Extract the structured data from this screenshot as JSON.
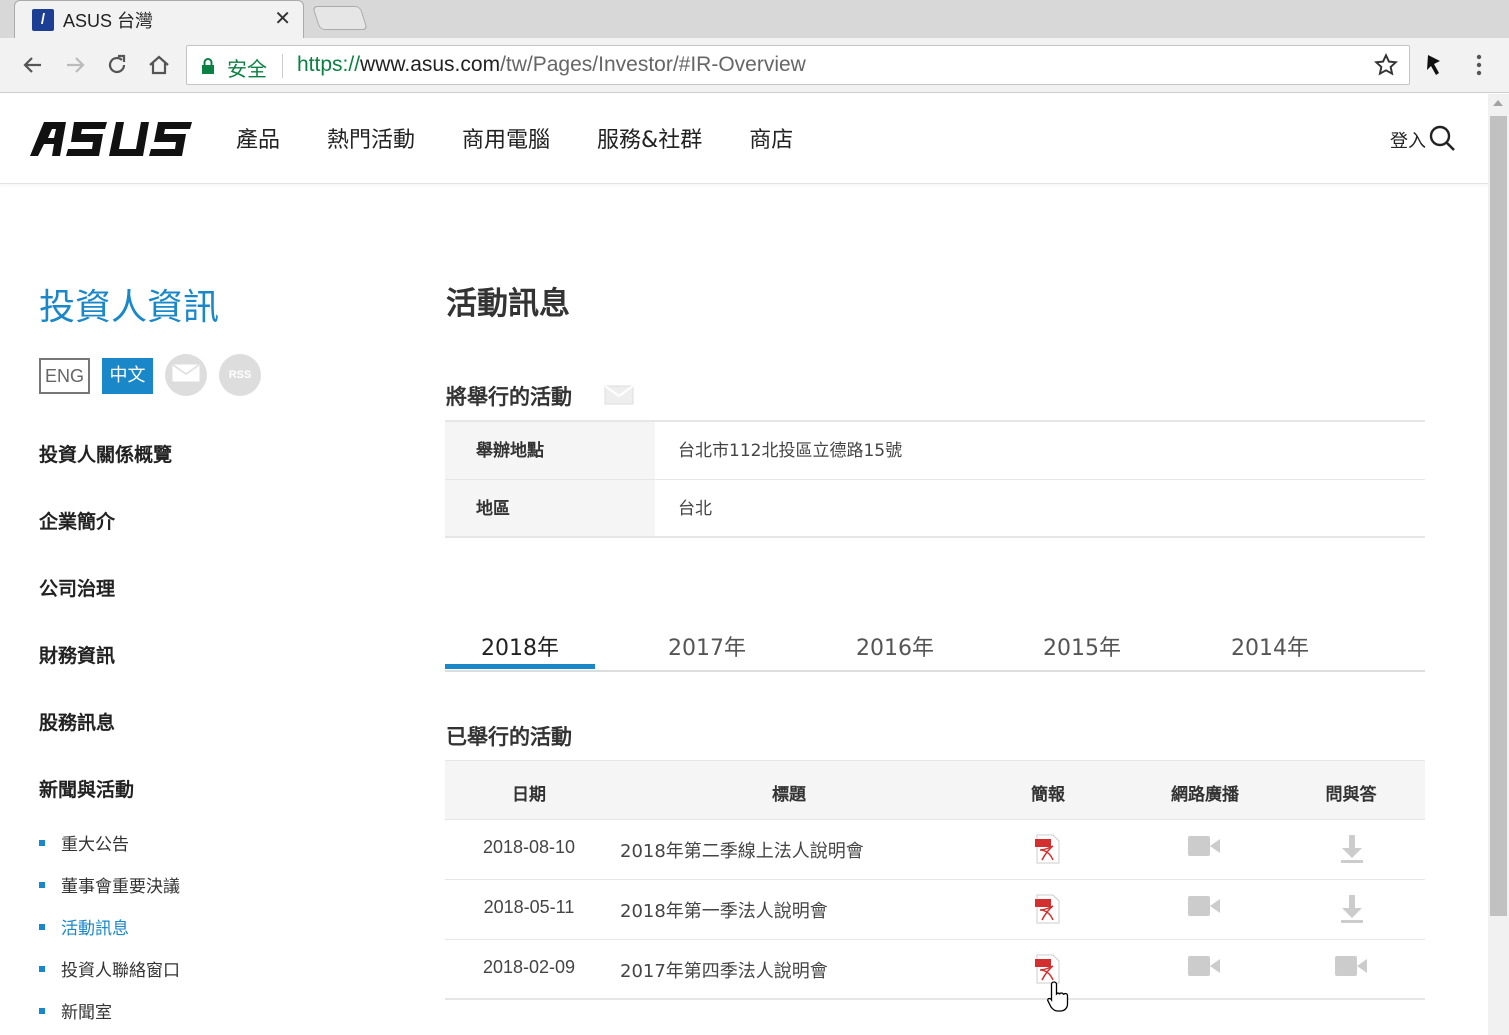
{
  "browser": {
    "tab_title": "ASUS 台灣",
    "tab_close": "✕",
    "secure_label": "安全",
    "url_scheme": "https://",
    "url_host": "www.asus.com",
    "url_path": "/tw/Pages/Investor/#IR-Overview"
  },
  "header": {
    "logo_alt": "ASUS",
    "nav": [
      "產品",
      "熱門活動",
      "商用電腦",
      "服務&社群",
      "商店"
    ],
    "login": "登入"
  },
  "sidebar": {
    "title": "投資人資訊",
    "lang_eng": "ENG",
    "lang_zh": "中文",
    "rss": "RSS",
    "items": [
      "投資人關係概覽",
      "企業簡介",
      "公司治理",
      "財務資訊",
      "股務訊息",
      "新聞與活動"
    ],
    "sub_items": [
      "重大公告",
      "董事會重要決議",
      "活動訊息",
      "投資人聯絡窗口",
      "新聞室"
    ],
    "active_sub_index": 2
  },
  "content": {
    "page_title": "活動訊息",
    "upcoming_title": "將舉行的活動",
    "info": [
      {
        "label": "舉辦地點",
        "value": "台北市112北投區立德路15號"
      },
      {
        "label": "地區",
        "value": "台北"
      }
    ],
    "year_tabs": [
      "2018年",
      "2017年",
      "2016年",
      "2015年",
      "2014年"
    ],
    "active_year_index": 0,
    "held_title": "已舉行的活動",
    "events_header": {
      "date": "日期",
      "title": "標題",
      "slides": "簡報",
      "webcast": "網路廣播",
      "qa": "問與答"
    },
    "events": [
      {
        "date": "2018-08-10",
        "title": "2018年第二季線上法人說明會",
        "slides": "pdf-icon",
        "webcast": "video-icon",
        "qa": "download-icon"
      },
      {
        "date": "2018-05-11",
        "title": "2018年第一季法人說明會",
        "slides": "pdf-icon",
        "webcast": "video-icon",
        "qa": "download-icon"
      },
      {
        "date": "2018-02-09",
        "title": "2017年第四季法人說明會",
        "slides": "pdf-icon",
        "webcast": "video-icon",
        "qa": "video-icon"
      }
    ]
  },
  "colors": {
    "accent": "#1a87c9",
    "secure": "#0b8043"
  }
}
